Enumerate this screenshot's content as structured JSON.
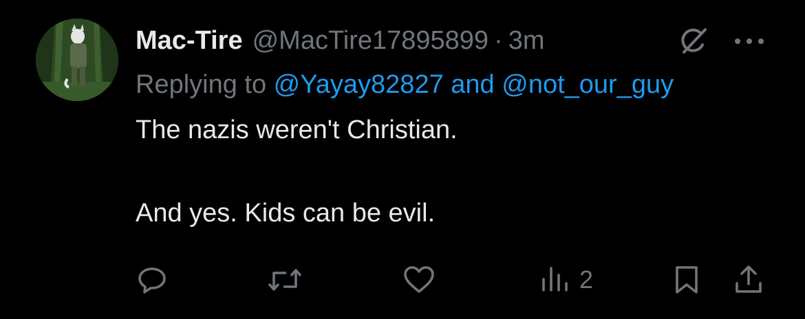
{
  "tweet": {
    "display_name": "Mac-Tire",
    "handle": "@MacTire17895899",
    "separator": "·",
    "time": "3m",
    "replying_prefix": "Replying to",
    "mention_1": "@Yayay82827",
    "and_word": "and",
    "mention_2": "@not_our_guy",
    "text_line_1": "The nazis weren't Christian.",
    "text_line_2": "And yes. Kids can be evil."
  },
  "actions": {
    "views_count": "2"
  },
  "icons": {
    "grok": "grok-icon",
    "more": "more-icon",
    "reply": "reply-icon",
    "retweet": "retweet-icon",
    "like": "heart-icon",
    "views": "views-chart-icon",
    "bookmark": "bookmark-icon",
    "share": "share-icon"
  },
  "colors": {
    "background": "#000000",
    "primary_text": "#e7e9ea",
    "secondary_text": "#71767b",
    "link": "#1d9bf0"
  }
}
